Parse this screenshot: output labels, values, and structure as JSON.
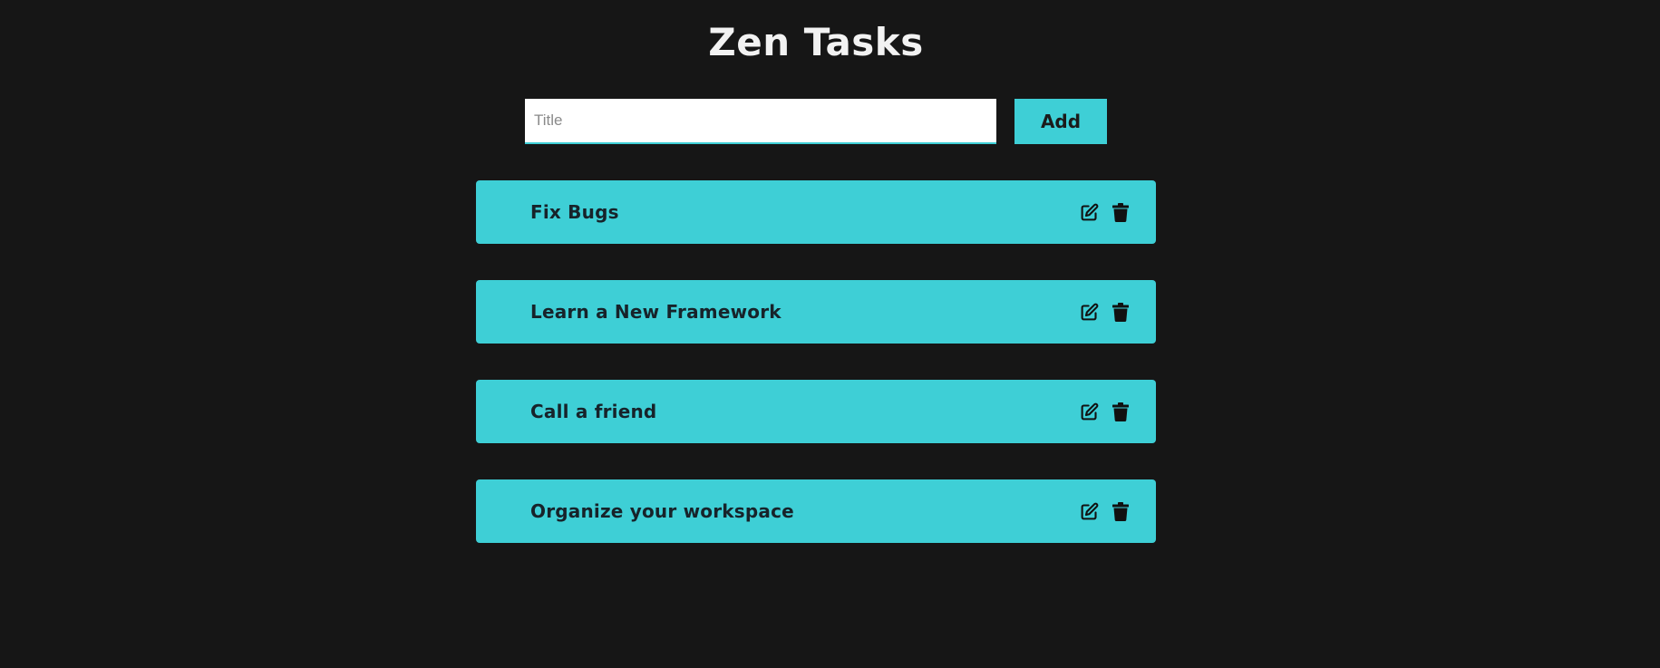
{
  "app": {
    "title": "Zen Tasks",
    "accent_color": "#3ecfd6",
    "background_color": "#161616"
  },
  "add_form": {
    "title_input": {
      "value": "",
      "placeholder": "Title"
    },
    "add_label": "Add"
  },
  "tasks": [
    {
      "title": "Fix Bugs",
      "icons": [
        "edit-icon",
        "trash-icon"
      ]
    },
    {
      "title": "Learn a New Framework",
      "icons": [
        "edit-icon",
        "trash-icon"
      ]
    },
    {
      "title": "Call a friend",
      "icons": [
        "edit-icon",
        "trash-icon"
      ]
    },
    {
      "title": "Organize your workspace",
      "icons": [
        "edit-icon",
        "trash-icon"
      ]
    }
  ]
}
